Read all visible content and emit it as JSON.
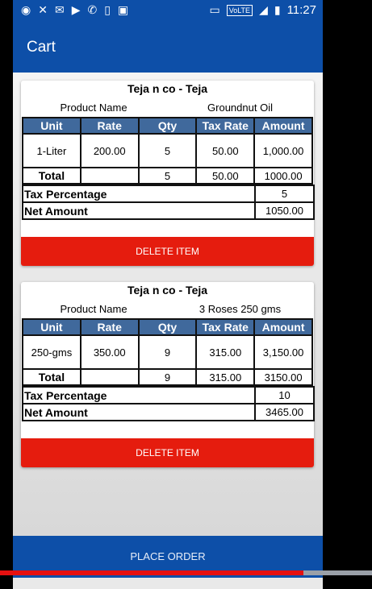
{
  "status_bar": {
    "time": "11:27",
    "volte": "VoLTE"
  },
  "appbar": {
    "title": "Cart"
  },
  "columns": [
    "Unit",
    "Rate",
    "Qty",
    "Tax Rate",
    "Amount"
  ],
  "product_label": "Product Name",
  "cards": [
    {
      "shop": "Teja n co - Teja",
      "product_name": "Groundnut Oil",
      "row": {
        "unit": "1-Liter",
        "rate": "200.00",
        "qty": "5",
        "tax_rate": "50.00",
        "amount": "1,000.00"
      },
      "total": {
        "label": "Total",
        "qty": "5",
        "tax_rate": "50.00",
        "amount": "1000.00"
      },
      "tax_percentage": {
        "label": "Tax Percentage",
        "value": "5"
      },
      "net_amount": {
        "label": "Net Amount",
        "value": "1050.00"
      },
      "delete_label": "DELETE ITEM"
    },
    {
      "shop": "Teja n co - Teja",
      "product_name": "3 Roses 250 gms",
      "row": {
        "unit": "250-gms",
        "rate": "350.00",
        "qty": "9",
        "tax_rate": "315.00",
        "amount": "3,150.00"
      },
      "total": {
        "label": "Total",
        "qty": "9",
        "tax_rate": "315.00",
        "amount": "3150.00"
      },
      "tax_percentage": {
        "label": "Tax Percentage",
        "value": "10"
      },
      "net_amount": {
        "label": "Net Amount",
        "value": "3465.00"
      },
      "delete_label": "DELETE ITEM"
    }
  ],
  "place_order_label": "PLACE ORDER",
  "video_progress": 0.815
}
